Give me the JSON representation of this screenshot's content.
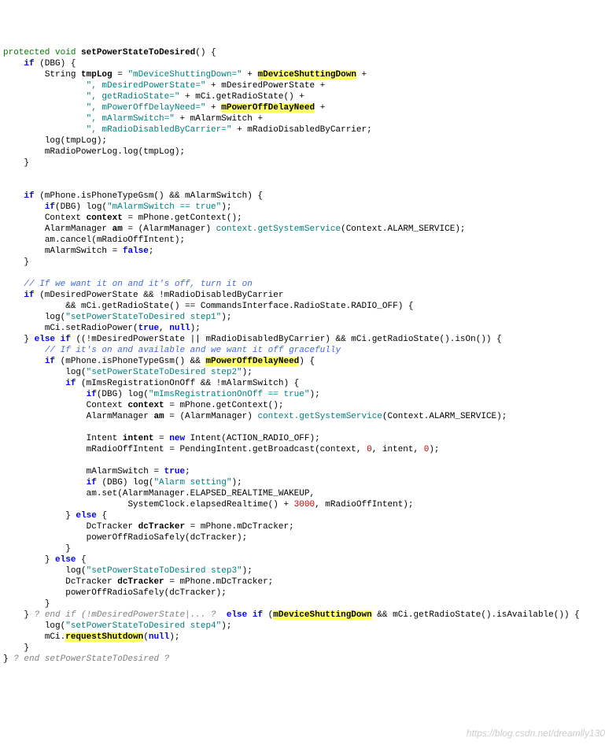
{
  "l01a": "protected",
  "l01b": "void",
  "l01c": "setPowerStateToDesired",
  "l01d": "() {",
  "l02a": "if",
  "l02b": " (DBG) {",
  "l03a": "String ",
  "l03b": "tmpLog",
  "l03c": " = ",
  "l03d": "\"mDeviceShuttingDown=\"",
  "l03e": " + ",
  "l03f": "mDeviceShuttingDown",
  "l03g": " +",
  "l04a": "\", mDesiredPowerState=\"",
  "l04b": " + mDesiredPowerState +",
  "l05a": "\", getRadioState=\"",
  "l05b": " + mCi.getRadioState() +",
  "l06a": "\", mPowerOffDelayNeed=\"",
  "l06b": " + ",
  "l06c": "mPowerOffDelayNeed",
  "l06d": " +",
  "l07a": "\", mAlarmSwitch=\"",
  "l07b": " + mAlarmSwitch +",
  "l08a": "\", mRadioDisabledByCarrier=\"",
  "l08b": " + mRadioDisabledByCarrier;",
  "l09": "log(tmpLog);",
  "l10": "mRadioPowerLog.log(tmpLog);",
  "l11": "}",
  "l13a": "if",
  "l13b": " (mPhone.isPhoneTypeGsm() && mAlarmSwitch) {",
  "l14a": "if",
  "l14b": "(DBG) log(",
  "l14c": "\"mAlarmSwitch == true\"",
  "l14d": ");",
  "l15a": "Context ",
  "l15b": "context",
  "l15c": " = mPhone.getContext();",
  "l16a": "AlarmManager ",
  "l16b": "am",
  "l16c": " = (AlarmManager) ",
  "l16d": "context.getSystemService",
  "l16e": "(Context.ALARM_SERVICE);",
  "l17": "am.cancel(mRadioOffIntent);",
  "l18a": "mAlarmSwitch = ",
  "l18b": "false",
  "l18c": ";",
  "l19": "}",
  "l21": "// If we want it on and it's off, turn it on",
  "l22a": "if",
  "l22b": " (mDesiredPowerState && !mRadioDisabledByCarrier",
  "l23": "&& mCi.getRadioState() == CommandsInterface.RadioState.RADIO_OFF) {",
  "l24a": "log(",
  "l24b": "\"setPowerStateToDesired step1\"",
  "l24c": ");",
  "l25a": "mCi.setRadioPower(",
  "l25b": "true",
  "l25c": ", ",
  "l25d": "null",
  "l25e": ");",
  "l26a": "}",
  "l26b": " else if ",
  "l26c": "((!mDesiredPowerState || mRadioDisabledByCarrier) && mCi.getRadioState().isOn()) {",
  "l27": "// If it's on and available and we want it off gracefully",
  "l28a": "if",
  "l28b": " (mPhone.isPhoneTypeGsm() && ",
  "l28c": "mPowerOffDelayNeed",
  "l28d": ") {",
  "l29a": "log(",
  "l29b": "\"setPowerStateToDesired step2\"",
  "l29c": ");",
  "l30a": "if",
  "l30b": " (mImsRegistrationOnOff && !mAlarmSwitch) {",
  "l31a": "if",
  "l31b": "(DBG) log(",
  "l31c": "\"mImsRegistrationOnOff == true\"",
  "l31d": ");",
  "l32a": "Context ",
  "l32b": "context",
  "l32c": " = mPhone.getContext();",
  "l33a": "AlarmManager ",
  "l33b": "am",
  "l33c": " = (AlarmManager) ",
  "l33d": "context.getSystemService",
  "l33e": "(Context.ALARM_SERVICE);",
  "l35a": "Intent ",
  "l35b": "intent",
  "l35c": " = ",
  "l35d": "new",
  "l35e": " Intent(ACTION_RADIO_OFF);",
  "l36a": "mRadioOffIntent = PendingIntent.getBroadcast(context, ",
  "l36b": "0",
  "l36c": ", intent, ",
  "l36d": "0",
  "l36e": ");",
  "l38a": "mAlarmSwitch = ",
  "l38b": "true",
  "l38c": ";",
  "l39a": "if",
  "l39b": " (DBG) log(",
  "l39c": "\"Alarm setting\"",
  "l39d": ");",
  "l40": "am.set(AlarmManager.ELAPSED_REALTIME_WAKEUP,",
  "l41a": "SystemClock.elapsedRealtime() + ",
  "l41b": "3000",
  "l41c": ", mRadioOffIntent);",
  "l42a": "}",
  "l42b": " else ",
  "l42c": "{",
  "l43a": "DcTracker ",
  "l43b": "dcTracker",
  "l43c": " = mPhone.mDcTracker;",
  "l44": "powerOffRadioSafely(dcTracker);",
  "l45": "}",
  "l46a": "}",
  "l46b": " else ",
  "l46c": "{",
  "l47a": "log(",
  "l47b": "\"setPowerStateToDesired step3\"",
  "l47c": ");",
  "l48a": "DcTracker ",
  "l48b": "dcTracker",
  "l48c": " = mPhone.mDcTracker;",
  "l49": "powerOffRadioSafely(dcTracker);",
  "l50": "}",
  "l51a": "}",
  "l51b": " ? end if (!mDesiredPowerState|... ?  ",
  "l51c": "else if ",
  "l51d": "(",
  "l51e": "mDeviceShuttingDown",
  "l51f": " && mCi.getRadioState().isAvailable()) {",
  "l52a": "log(",
  "l52b": "\"setPowerStateToDesired step4\"",
  "l52c": ");",
  "l53a": "mCi.",
  "l53b": "requestShutdown",
  "l53c": "(",
  "l53d": "null",
  "l53e": ");",
  "l54": "}",
  "l55a": "}",
  "l55b": " ? end setPowerStateToDesired ?",
  "watermark": "https://blog.csdn.net/dreamlly130"
}
